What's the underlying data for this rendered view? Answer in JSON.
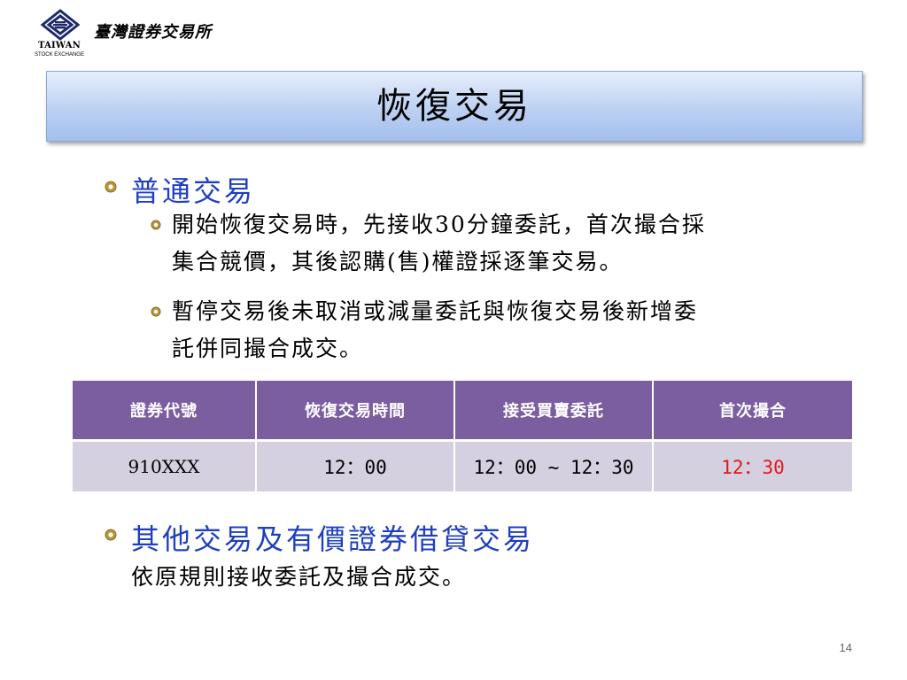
{
  "header": {
    "logo_text": "TAIWAN",
    "logo_subtext": "STOCK EXCHANGE",
    "org_name": "臺灣證券交易所"
  },
  "title": "恢復交易",
  "sections": [
    {
      "heading": "普通交易",
      "items": [
        {
          "line1": "開始恢復交易時，先接收30分鐘委託，首次撮合採",
          "line2": "集合競價，其後認購(售)權證採逐筆交易。"
        },
        {
          "line1": "暫停交易後未取消或減量委託與恢復交易後新增委",
          "line2": "託併同撮合成交。"
        }
      ]
    },
    {
      "heading": "其他交易及有價證券借貸交易",
      "text": "依原規則接收委託及撮合成交。"
    }
  ],
  "table": {
    "headers": [
      "證券代號",
      "恢復交易時間",
      "接受買賣委託",
      "首次撮合"
    ],
    "row": [
      "910XXX",
      "12：00",
      "12：00 ~ 12：30",
      "12：30"
    ]
  },
  "colors": {
    "heading_blue": "#1f3fbf",
    "table_header": "#7b5ea0",
    "table_cell": "#d5d0e0",
    "highlight_red": "#e01818",
    "bullet_gold": "#b8963a"
  },
  "icons": {
    "bullet": "gear-bullet-icon",
    "logo": "tse-logo-icon"
  },
  "page_number": "14"
}
